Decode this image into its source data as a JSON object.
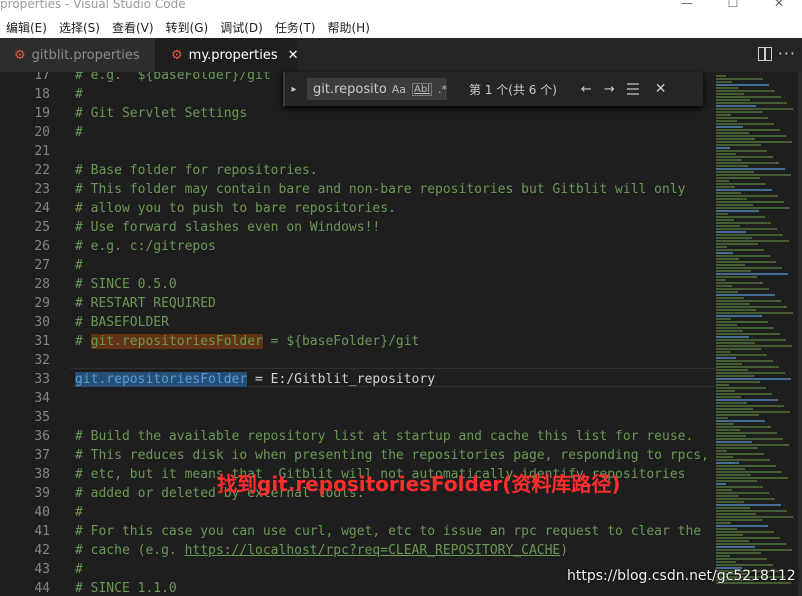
{
  "window": {
    "title": "properties - Visual Studio Code",
    "controls": [
      "—",
      "☐",
      "✕"
    ]
  },
  "menu": [
    "编辑(E)",
    "选择(S)",
    "查看(V)",
    "转到(G)",
    "调试(D)",
    "任务(T)",
    "帮助(H)"
  ],
  "tabs": [
    {
      "label": "gitblit.properties",
      "active": false
    },
    {
      "label": "my.properties",
      "active": true
    }
  ],
  "find": {
    "query": "git.repositoriesFol...",
    "case_option": "Aa",
    "word_option": "Abl",
    "regex_option": ".*",
    "result": "第 1 个(共 6 个)"
  },
  "lines": [
    {
      "n": "17",
      "parts": [
        {
          "t": "# e.g.  ${baseFolder}/git",
          "c": "cmt"
        }
      ]
    },
    {
      "n": "18",
      "parts": [
        {
          "t": "#",
          "c": "cmt"
        }
      ]
    },
    {
      "n": "19",
      "parts": [
        {
          "t": "# Git Servlet Settings",
          "c": "cmt"
        }
      ]
    },
    {
      "n": "20",
      "parts": [
        {
          "t": "#",
          "c": "cmt"
        }
      ]
    },
    {
      "n": "21",
      "parts": []
    },
    {
      "n": "22",
      "parts": [
        {
          "t": "# Base folder for repositories.",
          "c": "cmt"
        }
      ]
    },
    {
      "n": "23",
      "parts": [
        {
          "t": "# This folder may contain bare and non-bare repositories but Gitblit will only",
          "c": "cmt"
        }
      ]
    },
    {
      "n": "24",
      "parts": [
        {
          "t": "# allow you to push to bare repositories.",
          "c": "cmt"
        }
      ]
    },
    {
      "n": "25",
      "parts": [
        {
          "t": "# Use forward slashes even on Windows!!",
          "c": "cmt"
        }
      ]
    },
    {
      "n": "26",
      "parts": [
        {
          "t": "# e.g. c:/gitrepos",
          "c": "cmt"
        }
      ]
    },
    {
      "n": "27",
      "parts": [
        {
          "t": "#",
          "c": "cmt"
        }
      ]
    },
    {
      "n": "28",
      "parts": [
        {
          "t": "# SINCE 0.5.0",
          "c": "cmt"
        }
      ]
    },
    {
      "n": "29",
      "parts": [
        {
          "t": "# RESTART REQUIRED",
          "c": "cmt"
        }
      ]
    },
    {
      "n": "30",
      "parts": [
        {
          "t": "# BASEFOLDER",
          "c": "cmt"
        }
      ]
    },
    {
      "n": "31",
      "parts": [
        {
          "t": "# ",
          "c": "cmt"
        },
        {
          "t": "git.repositoriesFolder",
          "c": "cmt hl"
        },
        {
          "t": " = ${baseFolder}/git",
          "c": "cmt"
        }
      ]
    },
    {
      "n": "32",
      "parts": []
    },
    {
      "n": "33",
      "parts": [
        {
          "t": "git.repositoriesFolder",
          "c": "key hl2"
        },
        {
          "t": " = E:/Gitblit_repository",
          "c": "val"
        }
      ]
    },
    {
      "n": "34",
      "parts": []
    },
    {
      "n": "35",
      "parts": []
    },
    {
      "n": "36",
      "parts": [
        {
          "t": "# Build the available repository list at startup and cache this list for reuse.",
          "c": "cmt"
        }
      ]
    },
    {
      "n": "37",
      "parts": [
        {
          "t": "# This reduces disk io when presenting the repositories page, responding to rpcs,",
          "c": "cmt"
        }
      ]
    },
    {
      "n": "38",
      "parts": [
        {
          "t": "# etc, but it means that  Gitblit will not automatically identify repositories",
          "c": "cmt"
        }
      ]
    },
    {
      "n": "39",
      "parts": [
        {
          "t": "# added or deleted by external tools.",
          "c": "cmt"
        }
      ]
    },
    {
      "n": "40",
      "parts": [
        {
          "t": "#",
          "c": "cmt"
        }
      ]
    },
    {
      "n": "41",
      "parts": [
        {
          "t": "# For this case you can use curl, wget, etc to issue an rpc request to clear the",
          "c": "cmt"
        }
      ]
    },
    {
      "n": "42",
      "parts": [
        {
          "t": "# cache (e.g. ",
          "c": "cmt"
        },
        {
          "t": "https://localhost/rpc?req=CLEAR_REPOSITORY_CACHE",
          "c": "cmt link"
        },
        {
          "t": ")",
          "c": "cmt"
        }
      ]
    },
    {
      "n": "43",
      "parts": [
        {
          "t": "#",
          "c": "cmt"
        }
      ]
    },
    {
      "n": "44",
      "parts": [
        {
          "t": "# SINCE 1.1.0",
          "c": "cmt"
        }
      ]
    }
  ],
  "annotation": "找到git.repositoriesFolder(资料库路径)",
  "watermark": "https://blog.csdn.net/gc5218112",
  "colors": {
    "comment": "#6a9955",
    "key": "#569cd6",
    "text": "#d4d4d4",
    "annotation": "#ff2d2d",
    "find_highlight": "#613214",
    "selection": "#264f78"
  }
}
